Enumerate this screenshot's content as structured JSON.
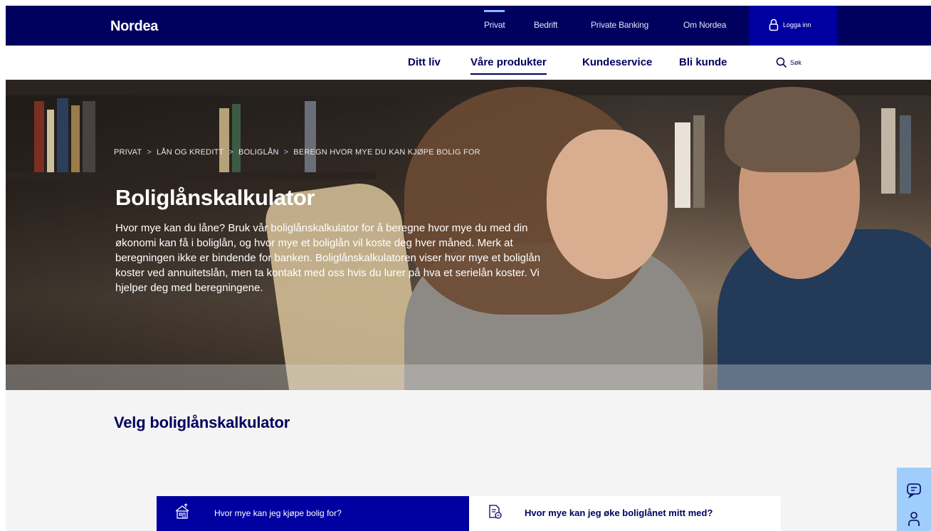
{
  "brand": {
    "logo_text": "Nordea"
  },
  "top_nav": {
    "items": [
      {
        "label": "Privat",
        "active": true
      },
      {
        "label": "Bedrift",
        "active": false
      },
      {
        "label": "Private Banking",
        "active": false
      },
      {
        "label": "Om Nordea",
        "active": false
      }
    ],
    "login_label": "Logga inn"
  },
  "main_nav": {
    "items": [
      {
        "label": "Ditt liv",
        "active": false
      },
      {
        "label": "Våre produkter",
        "active": true
      },
      {
        "label": "Kundeservice",
        "active": false
      },
      {
        "label": "Bli kunde",
        "active": false
      }
    ],
    "search_label": "Søk"
  },
  "hero": {
    "breadcrumb": [
      "PRIVAT",
      "LÅN OG KREDITT",
      "BOLIGLÅN",
      "BEREGN HVOR MYE DU KAN KJØPE BOLIG FOR"
    ],
    "title": "Boliglånskalkulator",
    "description": "Hvor mye kan du låne? Bruk vår boliglånskalkulator for å beregne hvor mye du med din økonomi kan få i boliglån, og hvor mye et boliglån vil koste deg hver måned. Merk at beregningen ikke er bindende for banken. Boliglånskalkulatoren viser hvor mye et boliglån koster ved annuitetslån, men ta kontakt med oss hvis du lurer på hva et serielån koster. Vi hjelper deg med beregningene."
  },
  "calculator_section": {
    "title": "Velg boliglånskalkulator",
    "options": [
      {
        "label": "Hvor mye kan jeg kjøpe bolig for?",
        "icon": "house-icon",
        "selected": true
      },
      {
        "label": "Hvor mye kan jeg øke boliglånet mitt med?",
        "icon": "document-icon",
        "selected": false
      }
    ]
  },
  "side_widget": {
    "icons": [
      "chat-icon",
      "person-icon"
    ]
  },
  "colors": {
    "brand_navy": "#00005e",
    "brand_blue": "#0000a0",
    "accent_light_blue": "#9fcdfc"
  }
}
